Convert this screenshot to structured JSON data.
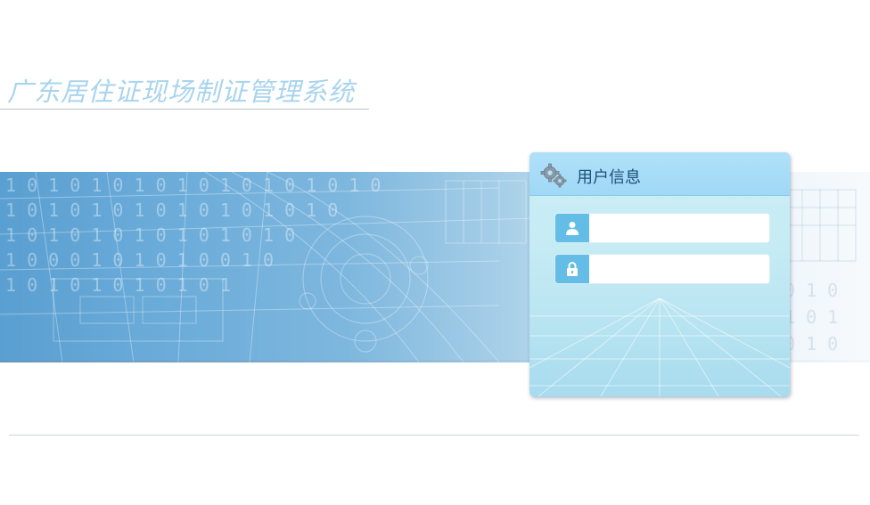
{
  "app": {
    "title": "广东居住证现场制证管理系统"
  },
  "login": {
    "header_title": "用户信息",
    "header_icon": "gears-icon",
    "username": {
      "value": "",
      "placeholder": "",
      "icon": "user-icon"
    },
    "password": {
      "value": "",
      "placeholder": "",
      "icon": "lock-icon"
    }
  },
  "banner": {
    "binary_digits": [
      "1",
      "0",
      "1",
      "0",
      "1",
      "0",
      "1",
      "0",
      "1",
      "0",
      "0",
      "1",
      "0",
      "1",
      "0",
      "1"
    ]
  },
  "colors": {
    "title": "#a8d4ee",
    "panel_header": "#9fd8f6",
    "field_icon_bg": "#64bde6",
    "header_text": "#1e4f7a"
  }
}
